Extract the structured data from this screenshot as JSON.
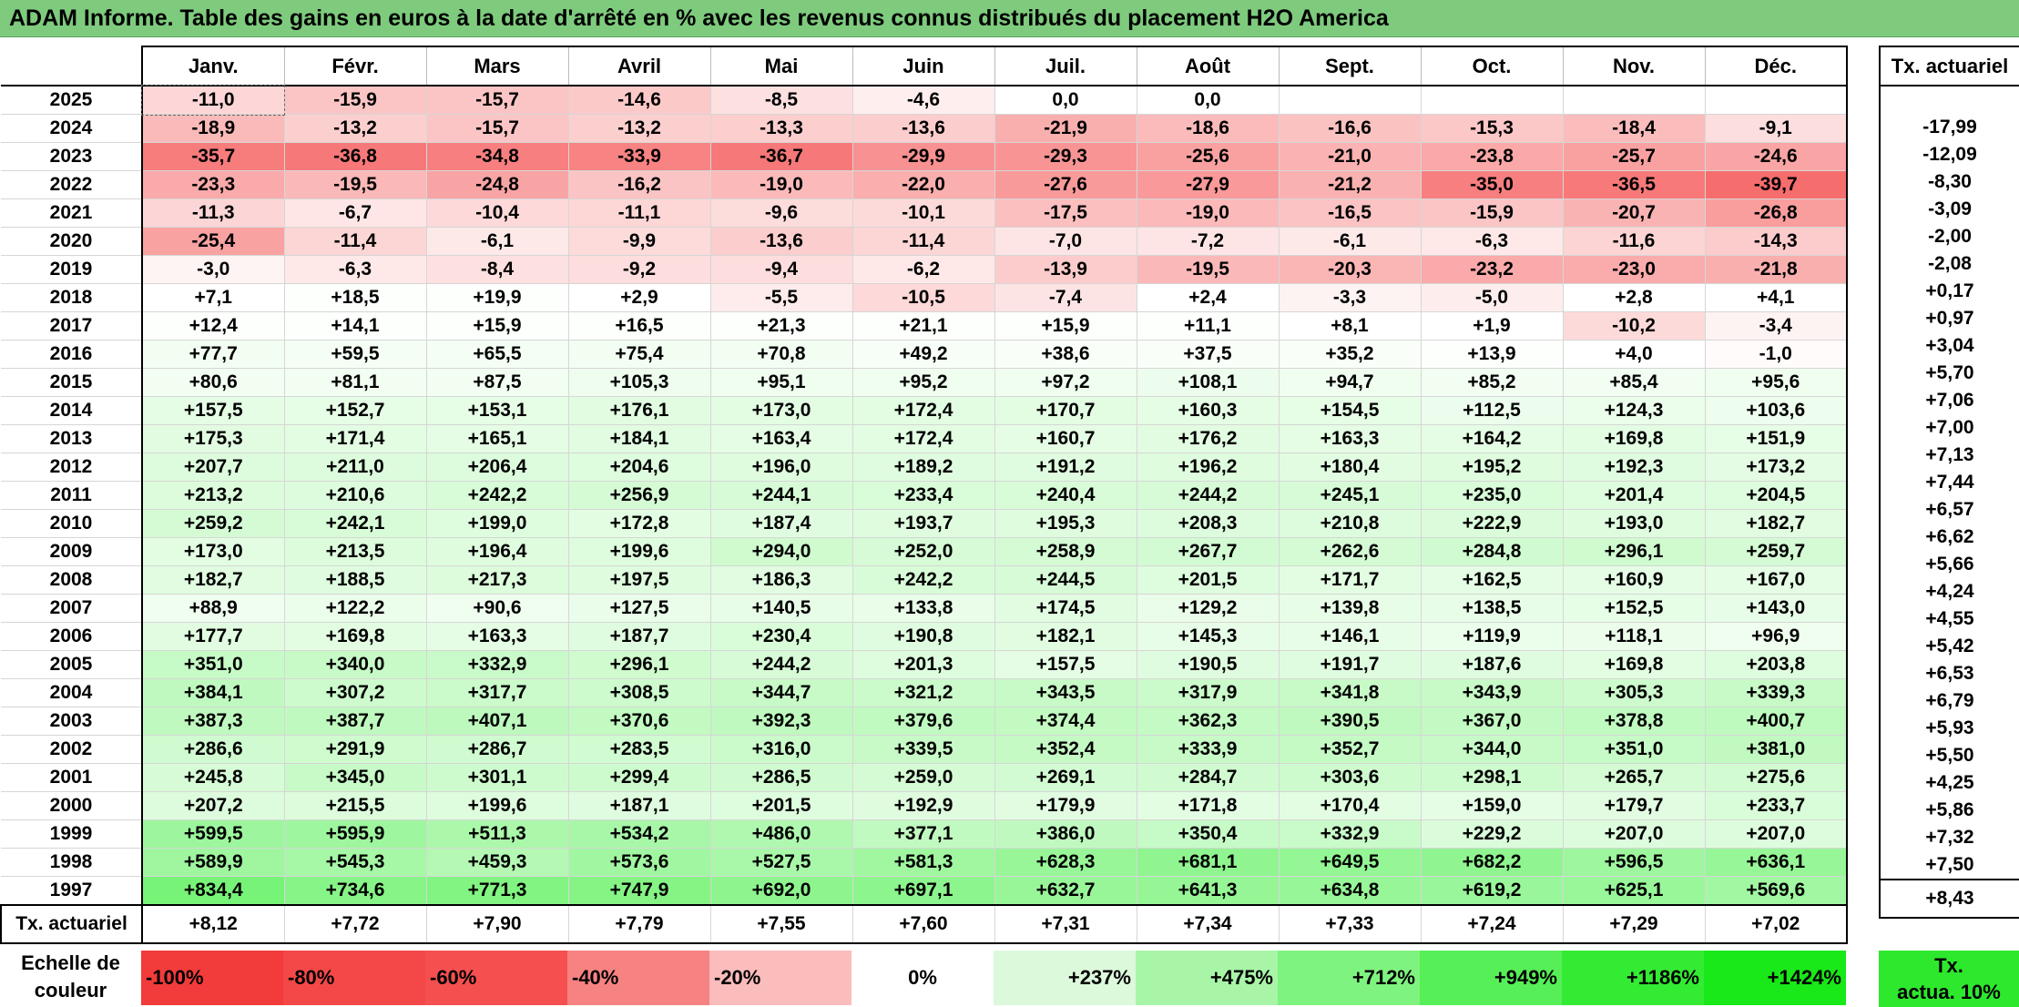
{
  "title": "ADAM Informe. Table des gains en euros à la date d'arrêté en % avec les revenus connus distribués du placement H2O America",
  "months": [
    "Janv.",
    "Févr.",
    "Mars",
    "Avril",
    "Mai",
    "Juin",
    "Juil.",
    "Août",
    "Sept.",
    "Oct.",
    "Nov.",
    "Déc."
  ],
  "right_header": "Tx. actuariel",
  "rows": [
    {
      "year": "2025",
      "values": [
        "-11,0",
        "-15,9",
        "-15,7",
        "-14,6",
        "-8,5",
        "-4,6",
        "0,0",
        "0,0",
        "",
        "",
        "",
        ""
      ],
      "tx": ""
    },
    {
      "year": "2024",
      "values": [
        "-18,9",
        "-13,2",
        "-15,7",
        "-13,2",
        "-13,3",
        "-13,6",
        "-21,9",
        "-18,6",
        "-16,6",
        "-15,3",
        "-18,4",
        "-9,1"
      ],
      "tx": "-17,99"
    },
    {
      "year": "2023",
      "values": [
        "-35,7",
        "-36,8",
        "-34,8",
        "-33,9",
        "-36,7",
        "-29,9",
        "-29,3",
        "-25,6",
        "-21,0",
        "-23,8",
        "-25,7",
        "-24,6"
      ],
      "tx": "-12,09"
    },
    {
      "year": "2022",
      "values": [
        "-23,3",
        "-19,5",
        "-24,8",
        "-16,2",
        "-19,0",
        "-22,0",
        "-27,6",
        "-27,9",
        "-21,2",
        "-35,0",
        "-36,5",
        "-39,7"
      ],
      "tx": "-8,30"
    },
    {
      "year": "2021",
      "values": [
        "-11,3",
        "-6,7",
        "-10,4",
        "-11,1",
        "-9,6",
        "-10,1",
        "-17,5",
        "-19,0",
        "-16,5",
        "-15,9",
        "-20,7",
        "-26,8"
      ],
      "tx": "-3,09"
    },
    {
      "year": "2020",
      "values": [
        "-25,4",
        "-11,4",
        "-6,1",
        "-9,9",
        "-13,6",
        "-11,4",
        "-7,0",
        "-7,2",
        "-6,1",
        "-6,3",
        "-11,6",
        "-14,3"
      ],
      "tx": "-2,00"
    },
    {
      "year": "2019",
      "values": [
        "-3,0",
        "-6,3",
        "-8,4",
        "-9,2",
        "-9,4",
        "-6,2",
        "-13,9",
        "-19,5",
        "-20,3",
        "-23,2",
        "-23,0",
        "-21,8"
      ],
      "tx": "-2,08"
    },
    {
      "year": "2018",
      "values": [
        "+7,1",
        "+18,5",
        "+19,9",
        "+2,9",
        "-5,5",
        "-10,5",
        "-7,4",
        "+2,4",
        "-3,3",
        "-5,0",
        "+2,8",
        "+4,1"
      ],
      "tx": "+0,17"
    },
    {
      "year": "2017",
      "values": [
        "+12,4",
        "+14,1",
        "+15,9",
        "+16,5",
        "+21,3",
        "+21,1",
        "+15,9",
        "+11,1",
        "+8,1",
        "+1,9",
        "-10,2",
        "-3,4"
      ],
      "tx": "+0,97"
    },
    {
      "year": "2016",
      "values": [
        "+77,7",
        "+59,5",
        "+65,5",
        "+75,4",
        "+70,8",
        "+49,2",
        "+38,6",
        "+37,5",
        "+35,2",
        "+13,9",
        "+4,0",
        "-1,0"
      ],
      "tx": "+3,04"
    },
    {
      "year": "2015",
      "values": [
        "+80,6",
        "+81,1",
        "+87,5",
        "+105,3",
        "+95,1",
        "+95,2",
        "+97,2",
        "+108,1",
        "+94,7",
        "+85,2",
        "+85,4",
        "+95,6"
      ],
      "tx": "+5,70"
    },
    {
      "year": "2014",
      "values": [
        "+157,5",
        "+152,7",
        "+153,1",
        "+176,1",
        "+173,0",
        "+172,4",
        "+170,7",
        "+160,3",
        "+154,5",
        "+112,5",
        "+124,3",
        "+103,6"
      ],
      "tx": "+7,06"
    },
    {
      "year": "2013",
      "values": [
        "+175,3",
        "+171,4",
        "+165,1",
        "+184,1",
        "+163,4",
        "+172,4",
        "+160,7",
        "+176,2",
        "+163,3",
        "+164,2",
        "+169,8",
        "+151,9"
      ],
      "tx": "+7,00"
    },
    {
      "year": "2012",
      "values": [
        "+207,7",
        "+211,0",
        "+206,4",
        "+204,6",
        "+196,0",
        "+189,2",
        "+191,2",
        "+196,2",
        "+180,4",
        "+195,2",
        "+192,3",
        "+173,2"
      ],
      "tx": "+7,13"
    },
    {
      "year": "2011",
      "values": [
        "+213,2",
        "+210,6",
        "+242,2",
        "+256,9",
        "+244,1",
        "+233,4",
        "+240,4",
        "+244,2",
        "+245,1",
        "+235,0",
        "+201,4",
        "+204,5"
      ],
      "tx": "+7,44"
    },
    {
      "year": "2010",
      "values": [
        "+259,2",
        "+242,1",
        "+199,0",
        "+172,8",
        "+187,4",
        "+193,7",
        "+195,3",
        "+208,3",
        "+210,8",
        "+222,9",
        "+193,0",
        "+182,7"
      ],
      "tx": "+6,57"
    },
    {
      "year": "2009",
      "values": [
        "+173,0",
        "+213,5",
        "+196,4",
        "+199,6",
        "+294,0",
        "+252,0",
        "+258,9",
        "+267,7",
        "+262,6",
        "+284,8",
        "+296,1",
        "+259,7"
      ],
      "tx": "+6,62"
    },
    {
      "year": "2008",
      "values": [
        "+182,7",
        "+188,5",
        "+217,3",
        "+197,5",
        "+186,3",
        "+242,2",
        "+244,5",
        "+201,5",
        "+171,7",
        "+162,5",
        "+160,9",
        "+167,0"
      ],
      "tx": "+5,66"
    },
    {
      "year": "2007",
      "values": [
        "+88,9",
        "+122,2",
        "+90,6",
        "+127,5",
        "+140,5",
        "+133,8",
        "+174,5",
        "+129,2",
        "+139,8",
        "+138,5",
        "+152,5",
        "+143,0"
      ],
      "tx": "+4,24"
    },
    {
      "year": "2006",
      "values": [
        "+177,7",
        "+169,8",
        "+163,3",
        "+187,7",
        "+230,4",
        "+190,8",
        "+182,1",
        "+145,3",
        "+146,1",
        "+119,9",
        "+118,1",
        "+96,9"
      ],
      "tx": "+4,55"
    },
    {
      "year": "2005",
      "values": [
        "+351,0",
        "+340,0",
        "+332,9",
        "+296,1",
        "+244,2",
        "+201,3",
        "+157,5",
        "+190,5",
        "+191,7",
        "+187,6",
        "+169,8",
        "+203,8"
      ],
      "tx": "+5,42"
    },
    {
      "year": "2004",
      "values": [
        "+384,1",
        "+307,2",
        "+317,7",
        "+308,5",
        "+344,7",
        "+321,2",
        "+343,5",
        "+317,9",
        "+341,8",
        "+343,9",
        "+305,3",
        "+339,3"
      ],
      "tx": "+6,53"
    },
    {
      "year": "2003",
      "values": [
        "+387,3",
        "+387,7",
        "+407,1",
        "+370,6",
        "+392,3",
        "+379,6",
        "+374,4",
        "+362,3",
        "+390,5",
        "+367,0",
        "+378,8",
        "+400,7"
      ],
      "tx": "+6,79"
    },
    {
      "year": "2002",
      "values": [
        "+286,6",
        "+291,9",
        "+286,7",
        "+283,5",
        "+316,0",
        "+339,5",
        "+352,4",
        "+333,9",
        "+352,7",
        "+344,0",
        "+351,0",
        "+381,0"
      ],
      "tx": "+5,93"
    },
    {
      "year": "2001",
      "values": [
        "+245,8",
        "+345,0",
        "+301,1",
        "+299,4",
        "+286,5",
        "+259,0",
        "+269,1",
        "+284,7",
        "+303,6",
        "+298,1",
        "+265,7",
        "+275,6"
      ],
      "tx": "+5,50"
    },
    {
      "year": "2000",
      "values": [
        "+207,2",
        "+215,5",
        "+199,6",
        "+187,1",
        "+201,5",
        "+192,9",
        "+179,9",
        "+171,8",
        "+170,4",
        "+159,0",
        "+179,7",
        "+233,7"
      ],
      "tx": "+4,25"
    },
    {
      "year": "1999",
      "values": [
        "+599,5",
        "+595,9",
        "+511,3",
        "+534,2",
        "+486,0",
        "+377,1",
        "+386,0",
        "+350,4",
        "+332,9",
        "+229,2",
        "+207,0",
        "+207,0"
      ],
      "tx": "+5,86"
    },
    {
      "year": "1998",
      "values": [
        "+589,9",
        "+545,3",
        "+459,3",
        "+573,6",
        "+527,5",
        "+581,3",
        "+628,3",
        "+681,1",
        "+649,5",
        "+682,2",
        "+596,5",
        "+636,1"
      ],
      "tx": "+7,32"
    },
    {
      "year": "1997",
      "values": [
        "+834,4",
        "+734,6",
        "+771,3",
        "+747,9",
        "+692,0",
        "+697,1",
        "+632,7",
        "+641,3",
        "+634,8",
        "+619,2",
        "+625,1",
        "+569,6"
      ],
      "tx": "+7,50"
    }
  ],
  "tx_row": {
    "label": "Tx. actuariel",
    "values": [
      "+8,12",
      "+7,72",
      "+7,90",
      "+7,79",
      "+7,55",
      "+7,60",
      "+7,31",
      "+7,34",
      "+7,33",
      "+7,24",
      "+7,29",
      "+7,02"
    ],
    "total": "+8,43"
  },
  "scale": {
    "label_line1": "Echelle de",
    "label_line2": "couleur",
    "items": [
      {
        "label": "-100%",
        "color": "#f23b3b",
        "kind": "neg"
      },
      {
        "label": "-80%",
        "color": "#f44848",
        "kind": "neg"
      },
      {
        "label": "-60%",
        "color": "#f54f4f",
        "kind": "neg"
      },
      {
        "label": "-40%",
        "color": "#f78282",
        "kind": "neg"
      },
      {
        "label": "-20%",
        "color": "#fbbcbc",
        "kind": "neg"
      },
      {
        "label": "0%",
        "color": "#ffffff",
        "kind": "zero"
      },
      {
        "label": "+237%",
        "color": "#dcf9dc",
        "kind": "pos"
      },
      {
        "label": "+475%",
        "color": "#a8f5a8",
        "kind": "pos"
      },
      {
        "label": "+712%",
        "color": "#7ff37f",
        "kind": "pos"
      },
      {
        "label": "+949%",
        "color": "#57ef57",
        "kind": "pos"
      },
      {
        "label": "+1186%",
        "color": "#33eb33",
        "kind": "pos"
      },
      {
        "label": "+1424%",
        "color": "#19e819",
        "kind": "pos"
      }
    ],
    "tx_line1": "Tx.",
    "tx_line2": "actua. 10%",
    "tx_color": "#2ee82e"
  }
}
